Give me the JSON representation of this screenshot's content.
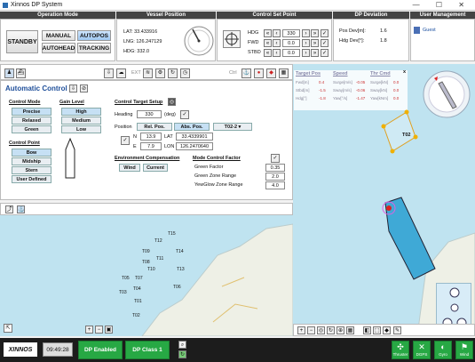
{
  "app": {
    "title": "Xinnos DP System",
    "window_controls": "— ☐ ✕"
  },
  "headers": {
    "operation_mode": "Operation Mode",
    "vessel_position": "Vessel Position",
    "control_set_point": "Control Set Point",
    "dp_deviation": "DP Deviation",
    "user_management": "User Management"
  },
  "operation_mode": {
    "standby": "STANDBY",
    "manual": "MANUAL",
    "autopos": "AUTOPOS",
    "autohead": "AUTOHEAD",
    "tracking": "TRACKING"
  },
  "vessel_position": {
    "lat": "LAT: 33.433916",
    "lng": "LNG: 126.247129",
    "hdg": "HDG: 332.0"
  },
  "set_point": {
    "rows": [
      {
        "label": "HDG",
        "value": "330"
      },
      {
        "label": "FWD",
        "value": "0.0"
      },
      {
        "label": "STBD",
        "value": "0.0"
      }
    ]
  },
  "dp_deviation": {
    "pos_label": "Pos Dev[m]:",
    "pos_value": "1.6",
    "hdg_label": "Hdg Dev[°]:",
    "hdg_value": "1.8"
  },
  "user": {
    "name": "Guest"
  },
  "toolbar": {
    "ext": "EXT",
    "ctrl": "Ctrl"
  },
  "auto_control": {
    "title": "Automatic Control",
    "control_mode": {
      "label": "Control Mode",
      "options": [
        "Precise",
        "Relaxed",
        "Green"
      ]
    },
    "gain_level": {
      "label": "Gain Level",
      "options": [
        "High",
        "Medium",
        "Low"
      ]
    },
    "control_point": {
      "label": "Control Point",
      "options": [
        "Bow",
        "Midship",
        "Stern",
        "User Defined"
      ]
    },
    "target_setup": {
      "label": "Control Target Setup",
      "heading_label": "Heading",
      "heading_value": "330",
      "heading_unit": "(deg)",
      "position_label": "Position",
      "rel_pos": "Rel. Pos.",
      "abs_pos": "Abs. Pos.",
      "target_select": "T02-2",
      "n_label": "N",
      "n_value": "13.9",
      "e_label": "E",
      "e_value": "7.9",
      "lat_label": "LAT",
      "lat_value": "33.4339901",
      "lon_label": "LON",
      "lon_value": "126.2470640"
    },
    "env_comp": {
      "label": "Environment Compensation",
      "wind": "Wind",
      "current": "Current"
    },
    "mode_factor": {
      "label": "Mode Control Factor",
      "rows": [
        {
          "label": "Green Factor",
          "value": "0.35"
        },
        {
          "label": "Green Zone Range",
          "value": "2.0"
        },
        {
          "label": "YewGlow Zone Range",
          "value": "4.0"
        }
      ]
    }
  },
  "targets_map": [
    "T15",
    "T12",
    "T09",
    "T14",
    "T11",
    "T08",
    "T10",
    "T13",
    "T05",
    "T07",
    "T04",
    "T06",
    "T03",
    "T01",
    "T02"
  ],
  "overlay_table": {
    "headers": [
      "Target Pos",
      "Speed",
      "Thr Cmd"
    ],
    "rows": [
      [
        "Fwd[m]",
        "0.4",
        "Surge[m/s]",
        "-0.05",
        "Surge[kN]",
        "0.0"
      ],
      [
        "Stbd[m]",
        "-1.5",
        "Sway[m/s]",
        "-0.06",
        "Sway[kN]",
        "0.0"
      ],
      [
        "Hdg[°]",
        "-1.8",
        "Yaw[°/s]",
        "-1.47",
        "Yaw[kNm]",
        "0.0"
      ]
    ],
    "close": "x"
  },
  "right_map": {
    "target_label": "T02"
  },
  "status": {
    "brand": "XINNOS",
    "time": "09:49:28",
    "dp_enabled": "DP Enabled",
    "dp_class": "DP Class 1"
  },
  "side_buttons": [
    {
      "label": "Thruster",
      "icon": "fan-icon"
    },
    {
      "label": "DGPS",
      "icon": "satellite-icon"
    },
    {
      "label": "Gyro",
      "icon": "compass-icon"
    },
    {
      "label": "Wind",
      "icon": "flag-icon"
    }
  ]
}
